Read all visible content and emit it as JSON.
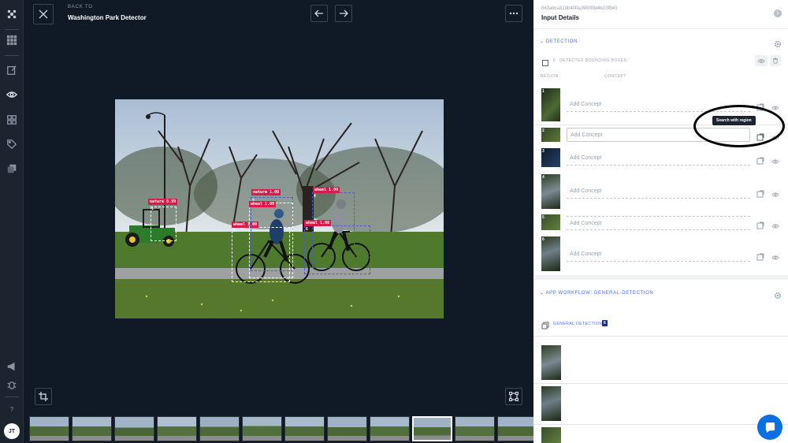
{
  "sidebar": {
    "logo": "app-logo-icon",
    "items": [
      "apps-grid-icon",
      "edit-icon",
      "eye-icon",
      "dashboard-icon",
      "tag-icon",
      "copy-icon"
    ],
    "bottom_items": [
      "megaphone-icon",
      "bug-icon",
      "help-icon"
    ],
    "help_label": "?",
    "avatar": "JT"
  },
  "header": {
    "back_to": "BACK TO",
    "dataset_name": "Washington Park Detector"
  },
  "detections": [
    {
      "label": "nature 0.99"
    },
    {
      "label": "wheel 1.00"
    },
    {
      "label": "nature 1.00"
    },
    {
      "label": "wheel 1.00"
    },
    {
      "label": "wheel 1.00"
    },
    {
      "label": "wheel 1.00"
    }
  ],
  "box_numbers": [
    "1",
    "2",
    "3",
    "4",
    "5",
    "6"
  ],
  "panel": {
    "input_id": "843abca32db4f4fa3980f8d4b23f840",
    "title": "Input Details",
    "detection_section": "DETECTION",
    "bbox_label": "DETECTED BOUNDING BOXES",
    "bbox_count": "6",
    "col_region": "REGION",
    "col_concept": "CONCEPT",
    "concept_placeholder": "Add Concept",
    "tooltip": "Search with region",
    "workflow_section": "APP WORKFLOW: GENERAL-DETECTION",
    "general_detection_label": "GENERAL DETECTION",
    "general_detection_count": "6"
  },
  "colors": {
    "accent": "#4a6cf0",
    "label_red": "#d81b4a",
    "dark_bg": "#101a26",
    "chat_blue": "#0a6fe0"
  }
}
